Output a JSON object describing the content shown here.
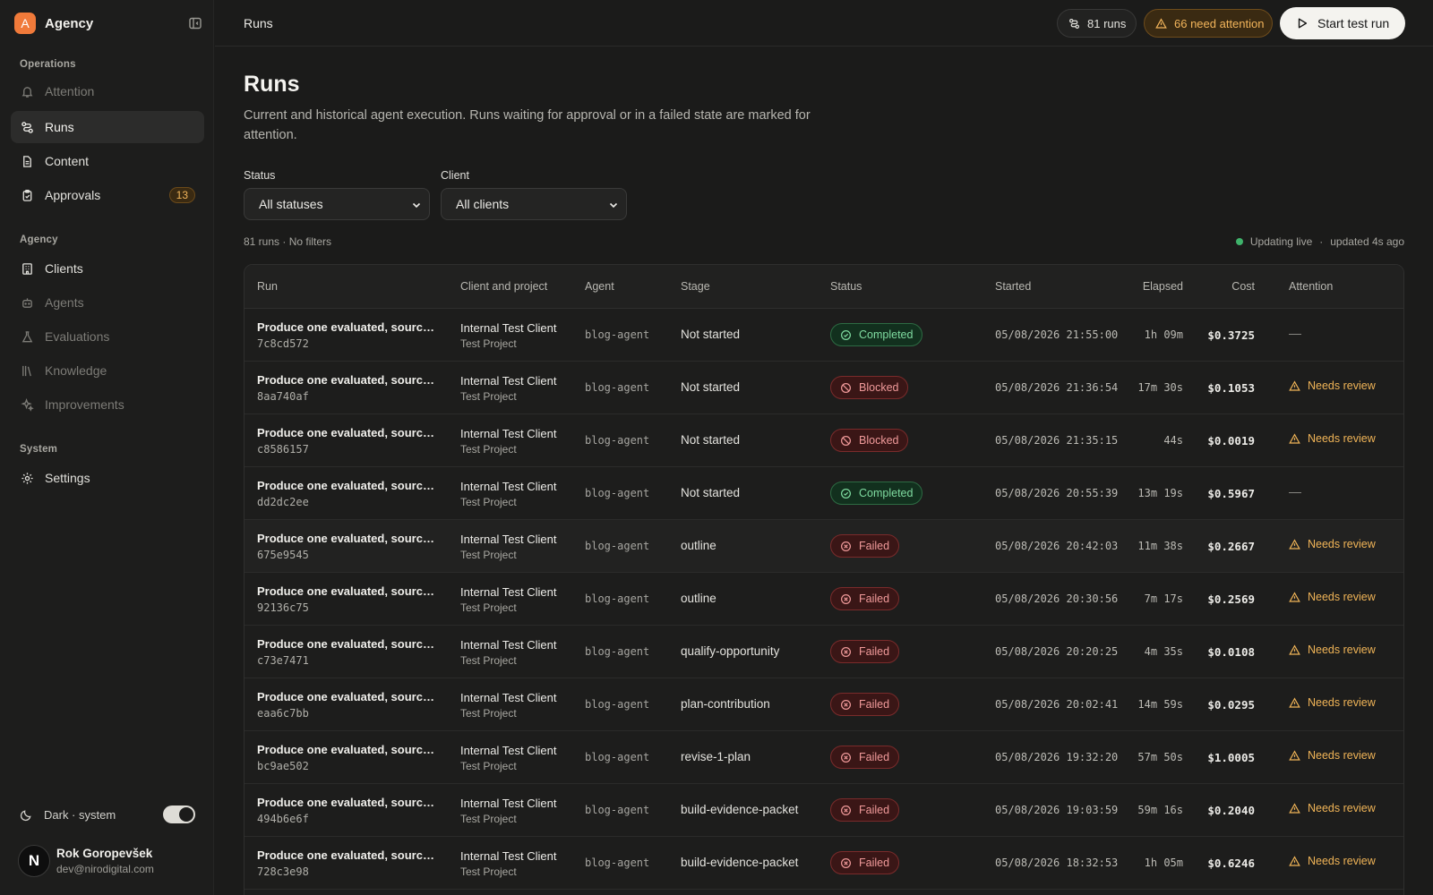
{
  "app": {
    "name": "Agency",
    "logo_letter": "A"
  },
  "sidebar": {
    "sections": [
      {
        "label": "Operations"
      },
      {
        "label": "Agency"
      },
      {
        "label": "System"
      }
    ],
    "items": [
      {
        "label": "Attention",
        "icon": "bell-icon"
      },
      {
        "label": "Runs",
        "icon": "route-icon"
      },
      {
        "label": "Content",
        "icon": "document-icon"
      },
      {
        "label": "Approvals",
        "icon": "clipboard-check-icon",
        "badge": "13"
      },
      {
        "label": "Clients",
        "icon": "building-icon"
      },
      {
        "label": "Agents",
        "icon": "bot-icon"
      },
      {
        "label": "Evaluations",
        "icon": "flask-icon"
      },
      {
        "label": "Knowledge",
        "icon": "library-icon"
      },
      {
        "label": "Improvements",
        "icon": "sparkles-icon"
      },
      {
        "label": "Settings",
        "icon": "gear-icon"
      }
    ],
    "theme": {
      "label": "Dark · system",
      "enabled": true
    },
    "user": {
      "initial": "N",
      "name": "Rok Goropevšek",
      "email": "dev@nirodigital.com"
    }
  },
  "topbar": {
    "breadcrumb": "Runs",
    "runs_pill": "81 runs",
    "attention_pill": "66 need attention",
    "start_button": "Start test run"
  },
  "main": {
    "title": "Runs",
    "description": "Current and historical agent execution. Runs waiting for approval or in a failed state are marked for attention.",
    "filters": {
      "status": {
        "label": "Status",
        "value": "All statuses"
      },
      "client": {
        "label": "Client",
        "value": "All clients"
      }
    },
    "count_line": "81 runs · No filters",
    "live": {
      "label": "Updating live",
      "separator": "·",
      "updated": "updated 4s ago"
    }
  },
  "table": {
    "columns": [
      "Run",
      "Client and project",
      "Agent",
      "Stage",
      "Status",
      "Started",
      "Elapsed",
      "Cost",
      "Attention"
    ],
    "rows": [
      {
        "title": "Produce one evaluated, source-backed blog post",
        "id": "7c8cd572",
        "client": "Internal Test Client",
        "project": "Test Project",
        "agent": "blog-agent",
        "stage": "Not started",
        "status": "Completed",
        "started": "05/08/2026 21:55:00",
        "elapsed": "1h 09m",
        "cost": "$0.3725",
        "attention": "—"
      },
      {
        "title": "Produce one evaluated, source-backed blog post",
        "id": "8aa740af",
        "client": "Internal Test Client",
        "project": "Test Project",
        "agent": "blog-agent",
        "stage": "Not started",
        "status": "Blocked",
        "started": "05/08/2026 21:36:54",
        "elapsed": "17m 30s",
        "cost": "$0.1053",
        "attention": "Needs review"
      },
      {
        "title": "Produce one evaluated, source-backed blog post",
        "id": "c8586157",
        "client": "Internal Test Client",
        "project": "Test Project",
        "agent": "blog-agent",
        "stage": "Not started",
        "status": "Blocked",
        "started": "05/08/2026 21:35:15",
        "elapsed": "44s",
        "cost": "$0.0019",
        "attention": "Needs review"
      },
      {
        "title": "Produce one evaluated, source-backed blog post",
        "id": "dd2dc2ee",
        "client": "Internal Test Client",
        "project": "Test Project",
        "agent": "blog-agent",
        "stage": "Not started",
        "status": "Completed",
        "started": "05/08/2026 20:55:39",
        "elapsed": "13m 19s",
        "cost": "$0.5967",
        "attention": "—"
      },
      {
        "title": "Produce one evaluated, source-backed blog post",
        "id": "675e9545",
        "client": "Internal Test Client",
        "project": "Test Project",
        "agent": "blog-agent",
        "stage": "outline",
        "status": "Failed",
        "started": "05/08/2026 20:42:03",
        "elapsed": "11m 38s",
        "cost": "$0.2667",
        "attention": "Needs review"
      },
      {
        "title": "Produce one evaluated, source-backed blog post",
        "id": "92136c75",
        "client": "Internal Test Client",
        "project": "Test Project",
        "agent": "blog-agent",
        "stage": "outline",
        "status": "Failed",
        "started": "05/08/2026 20:30:56",
        "elapsed": "7m 17s",
        "cost": "$0.2569",
        "attention": "Needs review"
      },
      {
        "title": "Produce one evaluated, source-backed blog post",
        "id": "c73e7471",
        "client": "Internal Test Client",
        "project": "Test Project",
        "agent": "blog-agent",
        "stage": "qualify-opportunity",
        "status": "Failed",
        "started": "05/08/2026 20:20:25",
        "elapsed": "4m 35s",
        "cost": "$0.0108",
        "attention": "Needs review"
      },
      {
        "title": "Produce one evaluated, source-backed blog post",
        "id": "eaa6c7bb",
        "client": "Internal Test Client",
        "project": "Test Project",
        "agent": "blog-agent",
        "stage": "plan-contribution",
        "status": "Failed",
        "started": "05/08/2026 20:02:41",
        "elapsed": "14m 59s",
        "cost": "$0.0295",
        "attention": "Needs review"
      },
      {
        "title": "Produce one evaluated, source-backed blog post",
        "id": "bc9ae502",
        "client": "Internal Test Client",
        "project": "Test Project",
        "agent": "blog-agent",
        "stage": "revise-1-plan",
        "status": "Failed",
        "started": "05/08/2026 19:32:20",
        "elapsed": "57m 50s",
        "cost": "$1.0005",
        "attention": "Needs review"
      },
      {
        "title": "Produce one evaluated, source-backed blog post",
        "id": "494b6e6f",
        "client": "Internal Test Client",
        "project": "Test Project",
        "agent": "blog-agent",
        "stage": "build-evidence-packet",
        "status": "Failed",
        "started": "05/08/2026 19:03:59",
        "elapsed": "59m 16s",
        "cost": "$0.2040",
        "attention": "Needs review"
      },
      {
        "title": "Produce one evaluated, source-backed blog post",
        "id": "728c3e98",
        "client": "Internal Test Client",
        "project": "Test Project",
        "agent": "blog-agent",
        "stage": "build-evidence-packet",
        "status": "Failed",
        "started": "05/08/2026 18:32:53",
        "elapsed": "1h 05m",
        "cost": "$0.6246",
        "attention": "Needs review"
      }
    ]
  },
  "colors": {
    "accent": "#f07a3a",
    "attention": "#f0b457",
    "success": "#7fdba0",
    "danger": "#f09a9a",
    "live_dot": "#3fb36b"
  }
}
